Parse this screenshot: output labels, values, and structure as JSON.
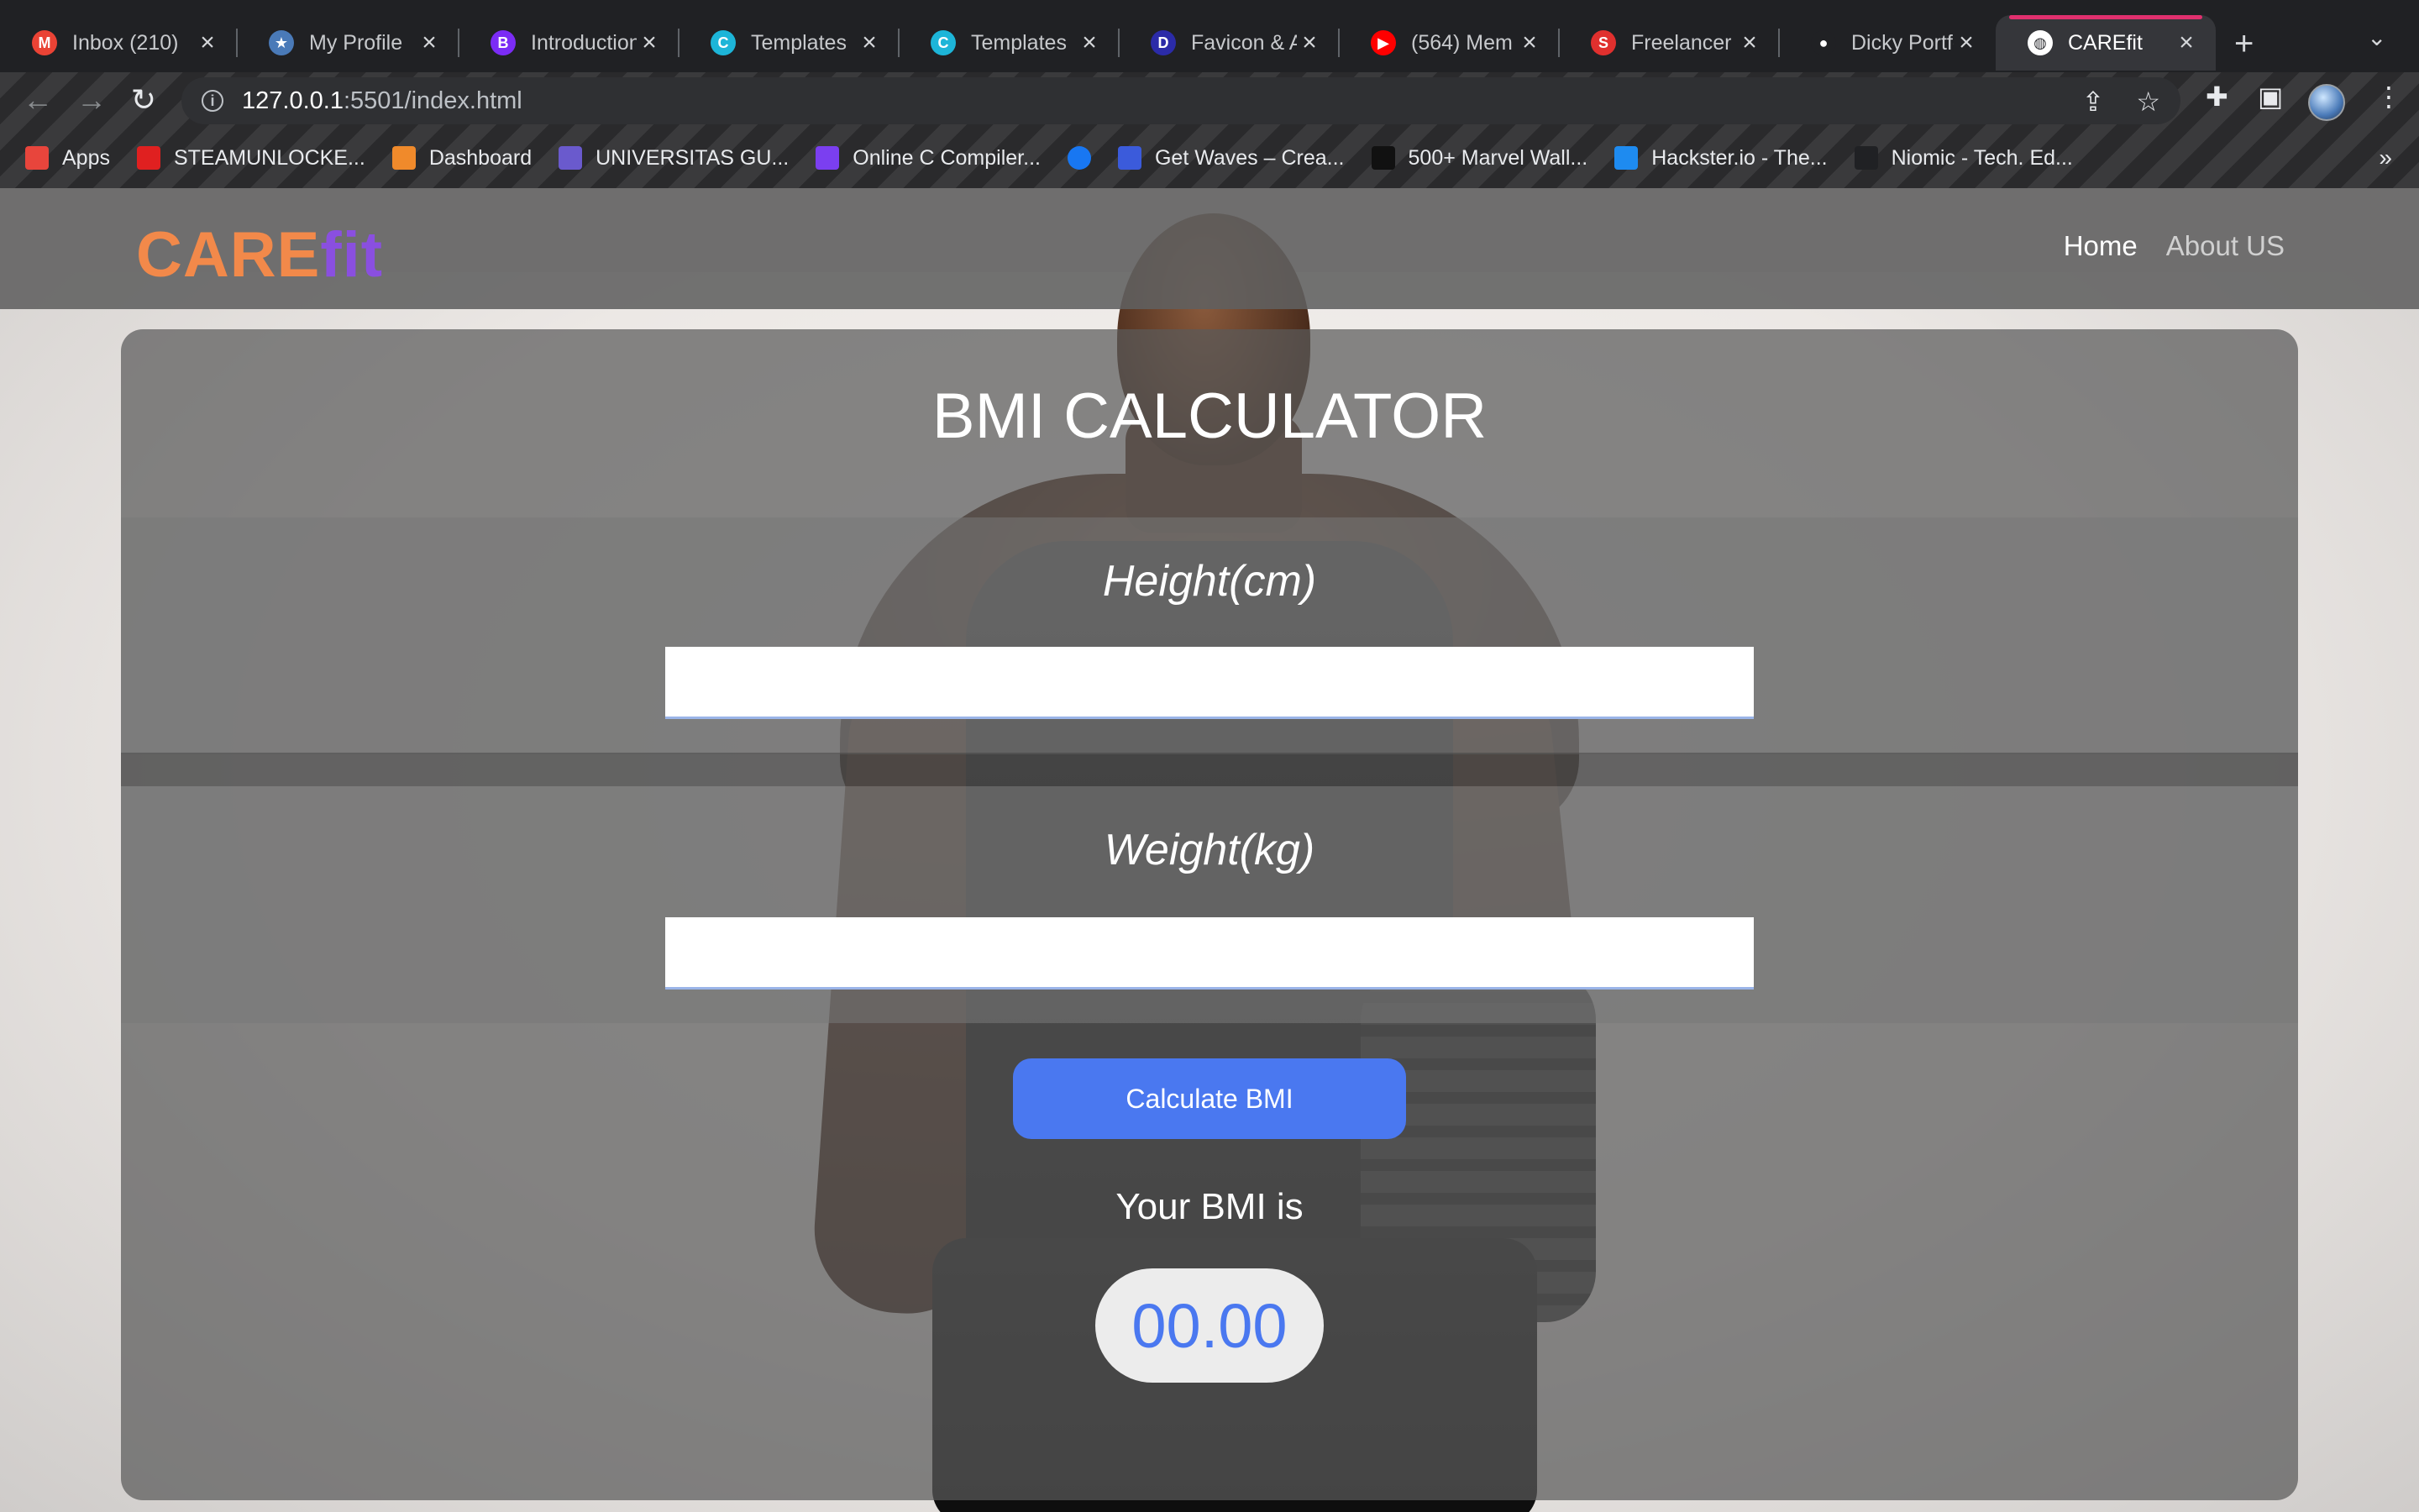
{
  "browser": {
    "tabs": [
      {
        "title": "Inbox (210)",
        "icon": "gmail-icon",
        "color": "#ea4335",
        "glyph": "M"
      },
      {
        "title": "My Profile",
        "icon": "profile-star-icon",
        "color": "#4a7ab8",
        "glyph": "★"
      },
      {
        "title": "Introduction",
        "icon": "bootstrap-icon",
        "color": "#7b2cf5",
        "glyph": "B"
      },
      {
        "title": "Templates",
        "icon": "canva-icon",
        "color": "#1db5d8",
        "glyph": "C"
      },
      {
        "title": "Templates",
        "icon": "canva-icon",
        "color": "#1db5d8",
        "glyph": "C"
      },
      {
        "title": "Favicon & A",
        "icon": "favicon-generator-icon",
        "color": "#2b2ba8",
        "glyph": "D"
      },
      {
        "title": "(564) Mem",
        "icon": "youtube-icon",
        "color": "#ff0000",
        "glyph": "▶"
      },
      {
        "title": "Freelancer",
        "icon": "freelancer-s-icon",
        "color": "#e0302e",
        "glyph": "S"
      },
      {
        "title": "Dicky Portfo",
        "icon": "github-icon",
        "color": "#202124",
        "glyph": "●"
      },
      {
        "title": "CAREfit",
        "icon": "globe-icon",
        "color": "#ffffff",
        "glyph": "◍",
        "active": true
      }
    ],
    "new_tab_label": "+",
    "address": {
      "host": "127.0.0.1",
      "rest": ":5501/index.html"
    },
    "bookmarks": [
      {
        "label": "Apps",
        "icon": "apps-grid-icon",
        "color": "#e8453c"
      },
      {
        "label": "STEAMUNLOCKE...",
        "icon": "steam-unlocked-icon",
        "color": "#e02020"
      },
      {
        "label": "Dashboard",
        "icon": "dashboard-icon",
        "color": "#f08a2b"
      },
      {
        "label": "UNIVERSITAS GU...",
        "icon": "university-seal-icon",
        "color": "#6a5acd"
      },
      {
        "label": "Online C Compiler...",
        "icon": "compiler-bolt-icon",
        "color": "#7b3ff0"
      },
      {
        "label": "",
        "icon": "facebook-icon",
        "color": "#1877f2"
      },
      {
        "label": "Get Waves – Crea...",
        "icon": "waves-icon",
        "color": "#3b5bdb"
      },
      {
        "label": "500+ Marvel Wall...",
        "icon": "marvel-icon",
        "color": "#111111"
      },
      {
        "label": "Hackster.io - The...",
        "icon": "hackster-icon",
        "color": "#1e8bf0"
      },
      {
        "label": "Niomic - Tech. Ed...",
        "icon": "niomic-icon",
        "color": "#202124"
      }
    ],
    "bookmarks_more": "»"
  },
  "site": {
    "logo_part1": "CARE",
    "logo_part2": "fit",
    "nav": {
      "home": "Home",
      "about": "About US"
    }
  },
  "calculator": {
    "title": "BMI CALCULATOR",
    "height_label": "Height(cm)",
    "height_value": "",
    "weight_label": "Weight(kg)",
    "weight_value": "",
    "button_label": "Calculate BMI",
    "result_label": "Your BMI is",
    "result_value": "00.00"
  },
  "colors": {
    "logo_orange": "#f2894a",
    "logo_purple": "#8a4fe0",
    "accent_blue": "#4a78f0",
    "active_tab_indicator": "#e0306e"
  }
}
